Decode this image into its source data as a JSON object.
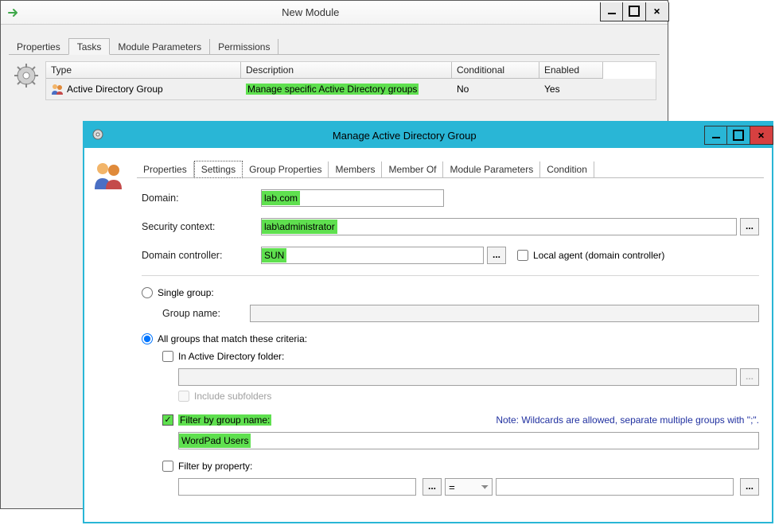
{
  "window1": {
    "title": "New Module",
    "tabs": [
      "Properties",
      "Tasks",
      "Module Parameters",
      "Permissions"
    ],
    "active_tab": 1,
    "table": {
      "headers": [
        "Type",
        "Description",
        "Conditional",
        "Enabled"
      ],
      "rows": [
        {
          "type": "Active Directory Group",
          "description": "Manage specific Active Directory groups",
          "conditional": "No",
          "enabled": "Yes"
        }
      ]
    }
  },
  "window2": {
    "title": "Manage Active Directory Group",
    "tabs": [
      "Properties",
      "Settings",
      "Group Properties",
      "Members",
      "Member Of",
      "Module Parameters",
      "Condition"
    ],
    "active_tab": 1,
    "form": {
      "domain_label": "Domain:",
      "domain_value": "lab.com",
      "secctx_label": "Security context:",
      "secctx_value": "lab\\administrator",
      "dc_label": "Domain controller:",
      "dc_value": "SUN",
      "local_agent_label": "Local agent (domain controller)",
      "single_group_label": "Single group:",
      "group_name_label": "Group name:",
      "all_groups_label": "All groups that match these criteria:",
      "in_ad_folder_label": "In Active Directory folder:",
      "include_subfolders_label": "Include subfolders",
      "filter_name_label": "Filter by group name:",
      "filter_name_note": "Note: Wildcards are allowed, separate multiple groups with \";\".",
      "filter_name_value": "WordPad Users",
      "filter_prop_label": "Filter by property:",
      "filter_operator": "="
    }
  }
}
